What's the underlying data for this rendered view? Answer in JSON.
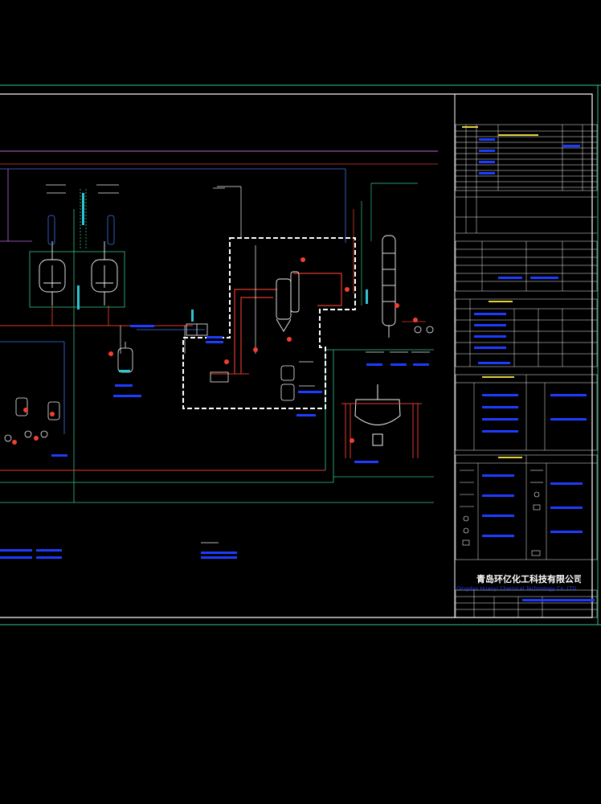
{
  "viewer": {
    "background": "#000000",
    "sheet_border_color": "#ffffff",
    "outer_line_color": "#35c487"
  },
  "colors": {
    "process_line": "#e03a2a",
    "utility_line": "#35c487",
    "steam_line": "#c06ad8",
    "water_line": "#3f6ff0",
    "equipment": "#f2f2f2",
    "instrument": "#f04030",
    "label": "#1e3cff",
    "table_line": "#f2f2f2",
    "table_accent": "#e6d23a",
    "highlight_box": "#ffffff"
  },
  "title_block": {
    "company_cn": "青岛环亿化工科技有限公司",
    "company_en": "Qingdao Huanyi Chemical Technology Co.,LTD"
  },
  "equipment_icons": [
    "reactor-icon",
    "evaporator-icon",
    "column-icon",
    "dryer-icon",
    "pump-icon",
    "condenser-icon",
    "tank-icon"
  ]
}
